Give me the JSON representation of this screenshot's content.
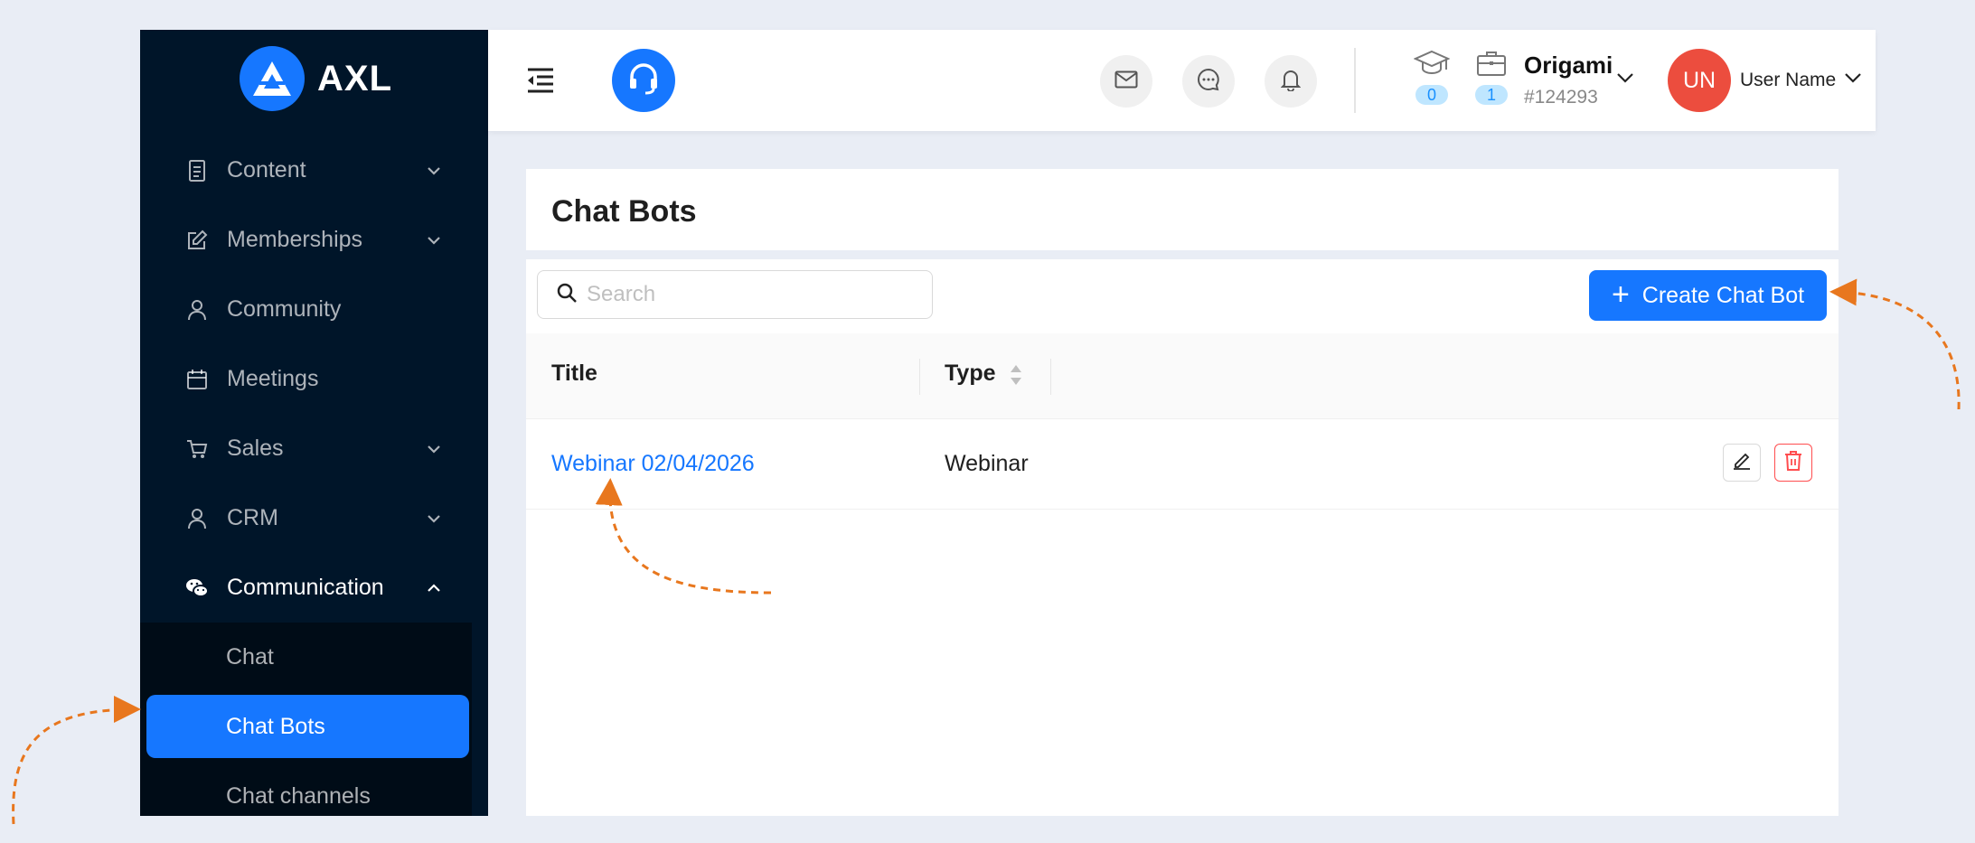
{
  "brand": {
    "name": "AXL"
  },
  "sidebar": {
    "items": [
      {
        "label": "Content",
        "icon": "document-icon",
        "chevron": "down"
      },
      {
        "label": "Memberships",
        "icon": "edit-icon",
        "chevron": "down"
      },
      {
        "label": "Community",
        "icon": "user-icon",
        "chevron": ""
      },
      {
        "label": "Meetings",
        "icon": "calendar-icon",
        "chevron": ""
      },
      {
        "label": "Sales",
        "icon": "cart-icon",
        "chevron": "down"
      },
      {
        "label": "CRM",
        "icon": "user-icon",
        "chevron": "down"
      },
      {
        "label": "Communication",
        "icon": "wechat-icon",
        "chevron": "up"
      }
    ],
    "submenu": [
      {
        "label": "Chat",
        "active": false
      },
      {
        "label": "Chat Bots",
        "active": true
      },
      {
        "label": "Chat channels",
        "active": false
      }
    ]
  },
  "header": {
    "stats": [
      {
        "icon": "graduation-cap-icon",
        "count": "0"
      },
      {
        "icon": "briefcase-icon",
        "count": "1"
      }
    ],
    "org": {
      "name": "Origami",
      "id": "#124293"
    },
    "user": {
      "initials": "UN",
      "name": "User Name"
    }
  },
  "page": {
    "title": "Chat Bots",
    "search_placeholder": "Search",
    "create_label": "Create Chat Bot"
  },
  "table": {
    "columns": [
      "Title",
      "Type"
    ],
    "rows": [
      {
        "title": "Webinar 02/04/2026",
        "type": "Webinar"
      }
    ]
  },
  "colors": {
    "primary": "#1677ff",
    "sidebar_bg": "#001529",
    "danger": "#ff4d4f",
    "avatar": "#ec4d3e",
    "annotation": "#e8771e"
  }
}
